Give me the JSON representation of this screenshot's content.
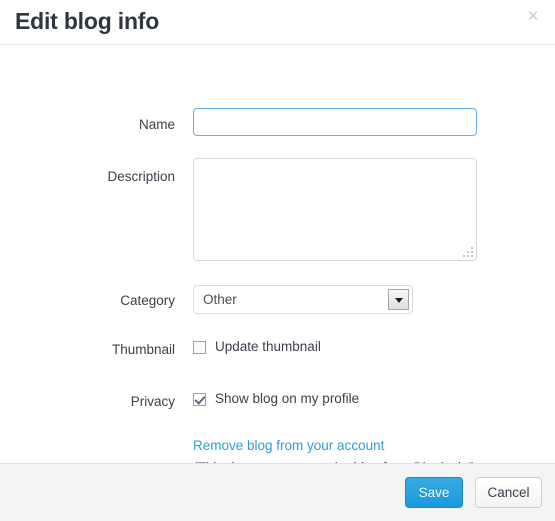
{
  "dialog": {
    "title": "Edit blog info",
    "close_icon": "close-icon",
    "close_label": "×"
  },
  "form": {
    "name": {
      "label": "Name",
      "value": "",
      "placeholder": ""
    },
    "description": {
      "label": "Description",
      "value": "",
      "placeholder": ""
    },
    "category": {
      "label": "Category",
      "selected": "Other"
    },
    "thumbnail": {
      "label": "Thumbnail",
      "checkbox_label": "Update thumbnail",
      "checked": false
    },
    "privacy": {
      "label": "Privacy",
      "checkbox_label": "Show blog on my profile",
      "checked": true
    }
  },
  "remove": {
    "link_text": "Remove blog from your account",
    "note": "(This does not remove the blog from Bloglovin')"
  },
  "footer": {
    "save_label": "Save",
    "cancel_label": "Cancel"
  },
  "colors": {
    "link": "#2a9fd8",
    "primary_button": "#1b9ade",
    "focus_border": "#66afe9",
    "footer_background": "#f4f4f4"
  }
}
